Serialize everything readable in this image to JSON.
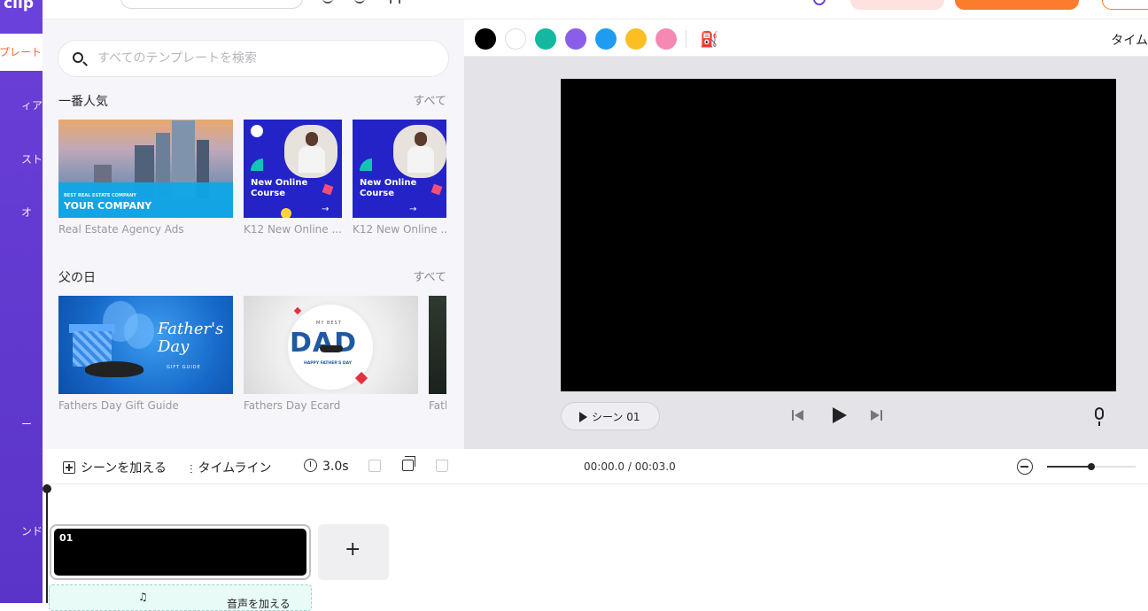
{
  "rail": {
    "logo_text": "clip",
    "active_label": "プレート",
    "items": [
      "ィア",
      "スト",
      "オ",
      "ー",
      "ンド"
    ]
  },
  "panel": {
    "search_placeholder": "すべてのテンプレートを検索",
    "sections": [
      {
        "title": "一番人気",
        "see_all": "すべて",
        "cards": [
          {
            "label": "Real Estate Agency Ads",
            "thumb_text_small": "BEST REAL ESTATE COMPANY",
            "thumb_text_big": "YOUR COMPANY"
          },
          {
            "label": "K12 New Online ...",
            "thumb_title": "New Online Course"
          },
          {
            "label": "K12 New Online ...",
            "thumb_title": "New Online Course"
          }
        ]
      },
      {
        "title": "父の日",
        "see_all": "すべて",
        "cards": [
          {
            "label": "Fathers Day Gift Guide",
            "thumb_script": "Father's Day",
            "thumb_sub": "GIFT GUIDE"
          },
          {
            "label": "Fathers Day Ecard",
            "thumb_top": "MY BEST",
            "thumb_big": "DAD",
            "thumb_bottom": "HAPPY FATHER'S DAY"
          },
          {
            "label": "Fatl"
          }
        ]
      }
    ]
  },
  "editor": {
    "colors": [
      "#000000",
      "#ffffff",
      "#14b8a0",
      "#8a5ee8",
      "#1f9bf0",
      "#fbbf24",
      "#f589b4"
    ],
    "right_label": "タイム",
    "scene_button": "シーン 01"
  },
  "toolbar": {
    "add_scene": "シーンを加える",
    "timeline": "タイムライン",
    "duration": "3.0s",
    "timecode": "00:00.0 / 00:03.0",
    "zoom_level": 0.5
  },
  "timeline": {
    "scene_number": "01",
    "add_label": "+",
    "audio_label": "音声を加える"
  }
}
